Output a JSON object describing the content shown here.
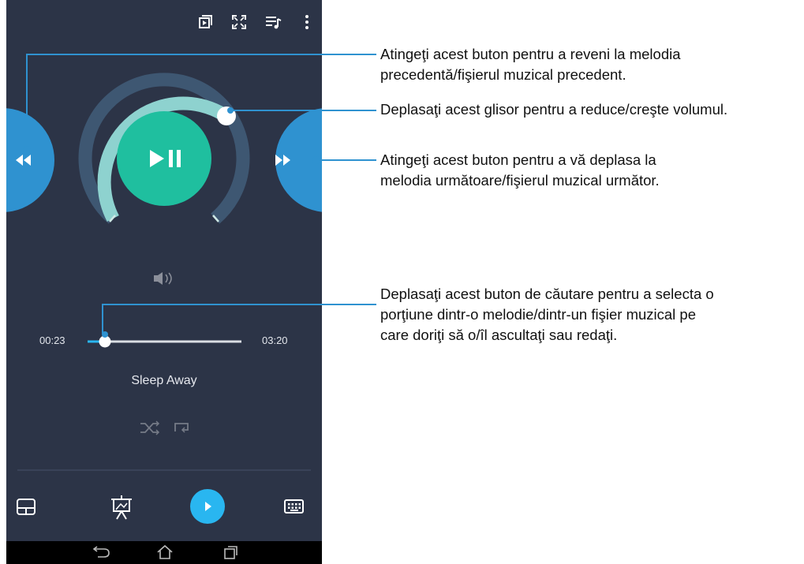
{
  "topbar": {
    "icons": [
      "queue-icon",
      "fullscreen-icon",
      "playlist-icon",
      "more-vert-icon"
    ]
  },
  "player": {
    "controls": {
      "prev_icon": "rewind-icon",
      "play_pause_icon": "play-pause-icon",
      "next_icon": "fast-forward-icon"
    },
    "volume_level": 0.5,
    "volume_icon": "volume-icon"
  },
  "seek": {
    "current_time": "00:23",
    "total_time": "03:20",
    "progress": 0.11
  },
  "song": {
    "title": "Sleep Away"
  },
  "modes": {
    "icons": [
      "shuffle-icon",
      "repeat-icon"
    ]
  },
  "bottombar": {
    "icons": [
      "touchpad-icon",
      "presentation-icon",
      "play-icon",
      "keyboard-icon"
    ]
  },
  "navbar": {
    "icons": [
      "back-icon",
      "home-icon",
      "recents-icon"
    ]
  },
  "colors": {
    "background": "#2c3447",
    "accent": "#1fbf9f",
    "ring_active": "#8ed2cf",
    "ring_inactive": "#3e5772",
    "side_buttons": "#2f92d0",
    "play_button": "#29b6f0"
  },
  "callouts": {
    "prev": {
      "line1": "Atingeţi acest buton pentru a reveni la melodia",
      "line2": "precedentă/fişierul muzical precedent."
    },
    "volume": {
      "line1": "Deplasaţi acest glisor pentru a reduce/creşte volumul."
    },
    "next": {
      "line1": "Atingeţi acest buton pentru a vă deplasa la",
      "line2": "melodia următoare/fişierul muzical următor."
    },
    "seek": {
      "line1": "Deplasaţi acest buton de căutare pentru a selecta o",
      "line2": "porţiune dintr-o melodie/dintr-un fişier muzical pe",
      "line3": "care doriţi să o/îl ascultaţi sau redaţi."
    }
  }
}
